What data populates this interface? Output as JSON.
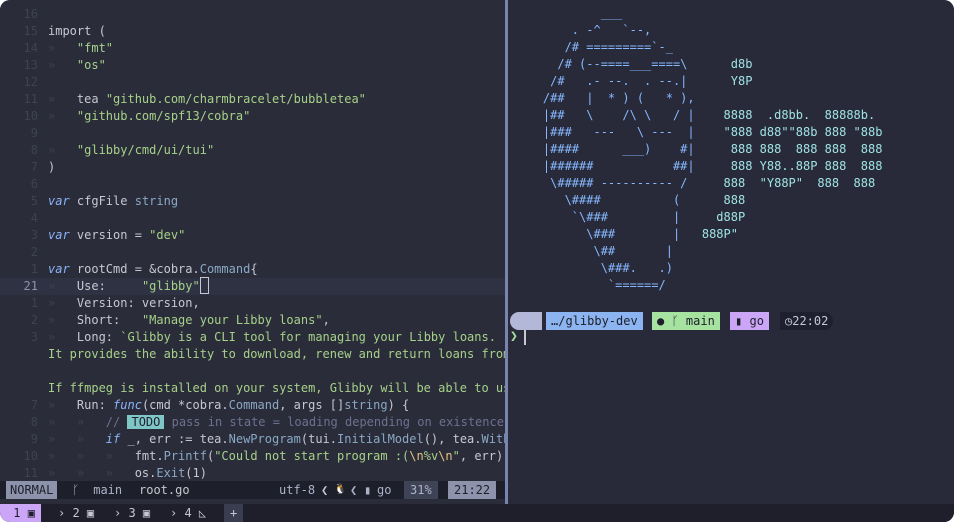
{
  "editor": {
    "lines": [
      {
        "n": "16",
        "segs": []
      },
      {
        "n": "15",
        "segs": [
          [
            "",
            "import ("
          ]
        ]
      },
      {
        "n": "14",
        "segs": [
          [
            "ind",
            "»   "
          ],
          [
            "str",
            "\"fmt\""
          ]
        ]
      },
      {
        "n": "13",
        "segs": [
          [
            "ind",
            "»   "
          ],
          [
            "str",
            "\"os\""
          ]
        ]
      },
      {
        "n": "12",
        "segs": []
      },
      {
        "n": "11",
        "segs": [
          [
            "ind",
            "»   "
          ],
          [
            "",
            "tea "
          ],
          [
            "str",
            "\"github.com/charmbracelet/bubbletea\""
          ]
        ]
      },
      {
        "n": "10",
        "segs": [
          [
            "ind",
            "»   "
          ],
          [
            "str",
            "\"github.com/spf13/cobra\""
          ]
        ]
      },
      {
        "n": "9",
        "segs": []
      },
      {
        "n": "8",
        "segs": [
          [
            "ind",
            "»   "
          ],
          [
            "str",
            "\"glibby/cmd/ui/tui\""
          ]
        ]
      },
      {
        "n": "7",
        "segs": [
          [
            "",
            ")"
          ]
        ]
      },
      {
        "n": "6",
        "segs": []
      },
      {
        "n": "5",
        "segs": [
          [
            "kw",
            "var"
          ],
          [
            "",
            " cfgFile "
          ],
          [
            "typ",
            "string"
          ]
        ]
      },
      {
        "n": "4",
        "segs": []
      },
      {
        "n": "3",
        "segs": [
          [
            "kw",
            "var"
          ],
          [
            "",
            " version = "
          ],
          [
            "str",
            "\"dev\""
          ]
        ]
      },
      {
        "n": "2",
        "segs": []
      },
      {
        "n": "1",
        "segs": [
          [
            "kw",
            "var"
          ],
          [
            "",
            " rootCmd = &cobra."
          ],
          [
            "fn",
            "Command"
          ],
          [
            "",
            "{"
          ]
        ]
      },
      {
        "n": "21",
        "cur": true,
        "segs": [
          [
            "ind",
            "»   "
          ],
          [
            "",
            "Use:     "
          ],
          [
            "str",
            "\"glibby\""
          ],
          [
            "cursor",
            ""
          ]
        ]
      },
      {
        "n": "1",
        "segs": [
          [
            "ind",
            "»   "
          ],
          [
            "",
            "Version: version,"
          ]
        ]
      },
      {
        "n": "2",
        "segs": [
          [
            "ind",
            "»   "
          ],
          [
            "",
            "Short:   "
          ],
          [
            "str",
            "\"Manage your Libby loans\""
          ],
          [
            "",
            ","
          ]
        ]
      },
      {
        "n": "3",
        "segs": [
          [
            "ind",
            "»   "
          ],
          [
            "",
            "Long: "
          ],
          [
            "str",
            "`Glibby is a CLI tool for managing your Libby loans."
          ]
        ]
      },
      {
        "n": "",
        "segs": [
          [
            "str",
            "It provides the ability to download, renew and return loans from"
          ]
        ]
      },
      {
        "n": "",
        "segs": []
      },
      {
        "n": "",
        "segs": [
          [
            "str",
            "If ffmpeg is installed on your system, Glibby will be able to use"
          ]
        ]
      },
      {
        "n": "7",
        "segs": [
          [
            "ind",
            "»   "
          ],
          [
            "",
            "Run: "
          ],
          [
            "kw",
            "func"
          ],
          [
            "",
            "(cmd *cobra."
          ],
          [
            "fn",
            "Command"
          ],
          [
            "",
            ", args []"
          ],
          [
            "typ",
            "string"
          ],
          [
            "",
            ") {"
          ]
        ]
      },
      {
        "n": "8",
        "segs": [
          [
            "ind",
            "»   »   "
          ],
          [
            "cmt",
            "// "
          ],
          [
            "todo",
            "TODO"
          ],
          [
            "cmt",
            " pass in state = loading depending on existence o"
          ]
        ]
      },
      {
        "n": "9",
        "segs": [
          [
            "ind",
            "»   »   "
          ],
          [
            "kw",
            "if"
          ],
          [
            "",
            " _, err := tea."
          ],
          [
            "fn",
            "NewProgram"
          ],
          [
            "",
            "(tui."
          ],
          [
            "fn",
            "InitialModel"
          ],
          [
            "",
            "(), tea."
          ],
          [
            "fn",
            "WithA"
          ]
        ]
      },
      {
        "n": "10",
        "segs": [
          [
            "ind",
            "»   »   »   "
          ],
          [
            "",
            "fmt."
          ],
          [
            "fn",
            "Printf"
          ],
          [
            "",
            "("
          ],
          [
            "str",
            "\"Could not start program :("
          ],
          [
            "esc",
            "\\n"
          ],
          [
            "str",
            "%v"
          ],
          [
            "esc",
            "\\n"
          ],
          [
            "str",
            "\""
          ],
          [
            "",
            ", err)"
          ]
        ]
      },
      {
        "n": "11",
        "segs": [
          [
            "ind",
            "»   »   »   "
          ],
          [
            "",
            "os."
          ],
          [
            "fn",
            "Exit"
          ],
          [
            "",
            "(1)"
          ]
        ]
      }
    ]
  },
  "statusline": {
    "mode": "NORMAL",
    "branch": " main",
    "file": "root.go",
    "encoding": "utf-8",
    "os_icon": "🐧",
    "filetype": "go",
    "percent": "31%",
    "position": "21:22"
  },
  "ascii_art": [
    [
      "",
      "            ___"
    ],
    [
      "",
      "        . -^   `--,"
    ],
    [
      "",
      "       /# =========`-_"
    ],
    [
      "",
      "      /# (--====___====\\      ",
      "d8b"
    ],
    [
      "",
      "     /#   .- --.  . --.|      ",
      "Y8P"
    ],
    [
      "",
      "    /##   |  * ) (   * ),"
    ],
    [
      "",
      "    |##   \\    /\\ \\   / |    ",
      "8888  .d8bb.  88888b."
    ],
    [
      "",
      "    |###   ---   \\ ---  |    ",
      "\"888 d88\"\"88b 888 \"88b"
    ],
    [
      "",
      "    |####      ___)    #|     ",
      "888 888  888 888  888"
    ],
    [
      "",
      "    |######           ##|     ",
      "888 Y88..88P 888  888"
    ],
    [
      "",
      "     \\##### ---------- /     ",
      "888  \"Y88P\"  888  888"
    ],
    [
      "",
      "       \\####          (      ",
      "888"
    ],
    [
      "",
      "        `\\###         |     ",
      "d88P"
    ],
    [
      "",
      "          \\###        |   ",
      "888P\""
    ],
    [
      "",
      "           \\##       |"
    ],
    [
      "",
      "            \\###.   .)"
    ],
    [
      "",
      "             `======/"
    ]
  ],
  "prompt": {
    "os_glyph": "",
    "directory": "…/glibby-dev",
    "git_branch": "main",
    "language": "go",
    "time": "22:02",
    "chevron": "❯"
  },
  "tabs": [
    {
      "label": "1",
      "active": true
    },
    {
      "label": "2",
      "active": false
    },
    {
      "label": "3",
      "active": false
    },
    {
      "label": "4",
      "active": false
    }
  ],
  "new_tab_label": "+"
}
